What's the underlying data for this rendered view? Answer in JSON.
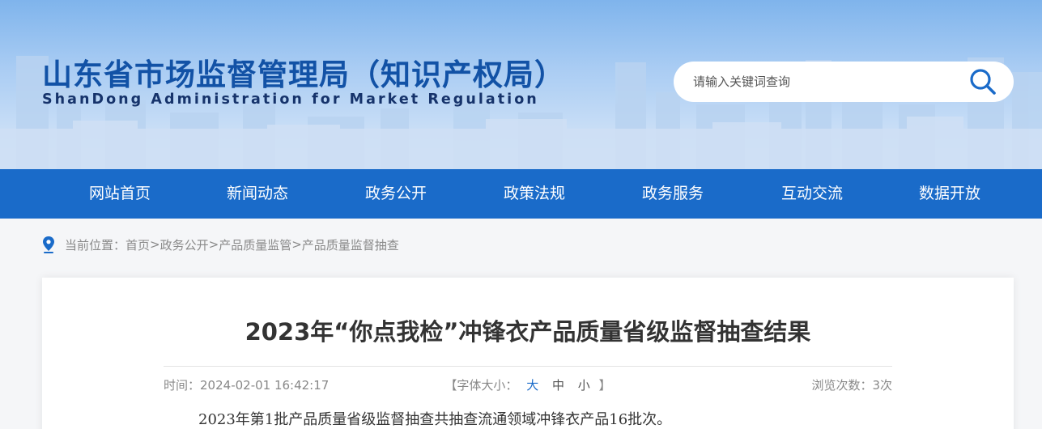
{
  "header": {
    "title": "山东省市场监督管理局（知识产权局）",
    "subtitle": "ShanDong Administration for Market Regulation",
    "search": {
      "placeholder": "请输入关键词查询",
      "value": "",
      "icon": "search-icon"
    }
  },
  "nav": {
    "items": [
      {
        "label": "网站首页"
      },
      {
        "label": "新闻动态"
      },
      {
        "label": "政务公开"
      },
      {
        "label": "政策法规"
      },
      {
        "label": "政务服务"
      },
      {
        "label": "互动交流"
      },
      {
        "label": "数据开放"
      }
    ]
  },
  "breadcrumb": {
    "icon": "location-pin-icon",
    "prefix": "当前位置：",
    "items": [
      "首页",
      "政务公开",
      "产品质量监管",
      "产品质量监督抽查"
    ],
    "separator": ">"
  },
  "article": {
    "title": "2023年“你点我检”冲锋衣产品质量省级监督抽查结果",
    "time_label": "时间：",
    "time": "2024-02-01 16:42:17",
    "font_size": {
      "bracket_open": "【",
      "label": "字体大小：",
      "options": [
        "大",
        "中",
        "小"
      ],
      "active": "大",
      "bracket_close": "】"
    },
    "views_label": "浏览次数：",
    "views": "3次",
    "body": "2023年第1批产品质量省级监督抽查共抽查流通领域冲锋衣产品16批次。"
  },
  "colors": {
    "nav_bg": "#1a6bc9",
    "title_blue": "#1252a6",
    "accent": "#1a6bc9"
  }
}
